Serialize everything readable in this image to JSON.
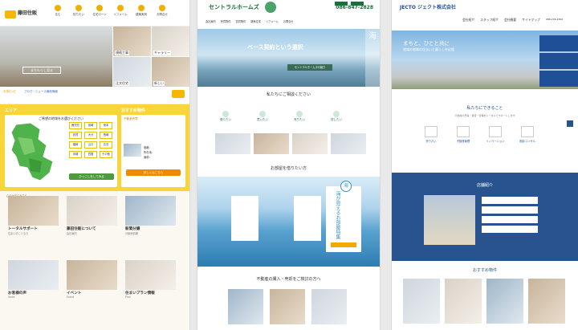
{
  "panel1": {
    "brand": "藤田住販",
    "nav": [
      "住む",
      "知りたい",
      "住宅ローン",
      "リフォーム",
      "建築実例",
      "お問合せ"
    ],
    "hero_label": "まちもらし見る",
    "thumb_labels": [
      "規格工事",
      "ギャラリー",
      "注文住宅",
      "新しい"
    ],
    "news_title": "お知らせ",
    "news_link": "ブログ・ニュース最新情報",
    "area_title": "エリア",
    "area_title2": "おすすめ物件",
    "map_caption": "ご希望の地域をお選びください",
    "regions": [
      "鹿児島",
      "宮崎",
      "熊本",
      "佐賀",
      "大分",
      "長崎",
      "福岡",
      "山口",
      "広島",
      "沖縄",
      "四国",
      "その他"
    ],
    "map_button": "ひっこしをしてみる",
    "side_heading": "不動産売買",
    "side_rows": [
      "価格：",
      "所在地：",
      "面積："
    ],
    "side_button": "詳しくはこちら",
    "contents_label": "CONTENTS",
    "cards": [
      {
        "title": "トータルサポート",
        "desc": "住まいのことなら"
      },
      {
        "title": "藤田住販について",
        "desc": "会社案内"
      },
      {
        "title": "新築分譲",
        "desc": "分譲地情報"
      },
      {
        "title": "お客様の声",
        "desc": "Voice"
      },
      {
        "title": "イベント",
        "desc": "Event"
      },
      {
        "title": "住まいプラン情報",
        "desc": "Plan"
      }
    ]
  },
  "panel2": {
    "logo": "セントラルホームズ",
    "tel": "086-847-2828",
    "nav": [
      "会社案内",
      "売買物件",
      "賃貸物件",
      "新築住宅",
      "リフォーム",
      "お問合せ"
    ],
    "hero_title": "ベース契約という選択",
    "hero_side": "海",
    "hero_badge": "セントラルホームズの魅力",
    "sec1_title": "私たちにご相談ください",
    "cats": [
      "借りたい",
      "買いたい",
      "売りたい",
      "貸したい"
    ],
    "sec2_title": "お部屋を借りたい方",
    "sea_circle": "海",
    "sea_vertical": "海が見えるお部屋特集",
    "sec3_title": "不動産の購入・売却をご検討の方へ"
  },
  "panel3": {
    "logo": "JECTO ジェクト株式会社",
    "nav": [
      "会社紹介",
      "スタッフ紹介",
      "会社概要",
      "サイトマップ"
    ],
    "tel": "086-236-1300",
    "hero_t1": "まちと、ひとと共に",
    "hero_t2": "地域の皆様の住まいと暮らしを応援",
    "sec1_title": "私たちにできること",
    "sec1_desc": "不動産の売買・賃貸・管理をトータルでサポートします",
    "services": [
      "売りたい",
      "不動産管理",
      "リノベーション",
      "相談コンサル"
    ],
    "shop_title": "店舗紹介",
    "sec3_title": "おすすめ物件"
  }
}
